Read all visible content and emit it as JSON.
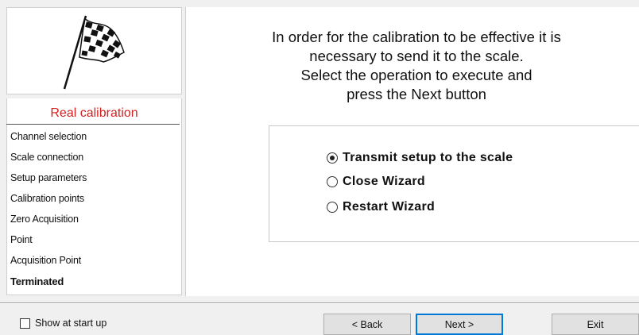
{
  "sidebar": {
    "title": "Real calibration",
    "steps": [
      "Channel selection",
      "Scale connection",
      "Setup parameters",
      "Calibration points",
      "Zero Acquisition",
      "Point",
      "Acquisition Point",
      "Terminated"
    ],
    "current_step": "Terminated",
    "title_color": "#d42020"
  },
  "main": {
    "instructions": [
      "In order for the calibration to be effective it is",
      "necessary to send it to the scale.",
      "Select the operation to execute and",
      "press the Next button"
    ],
    "options": [
      {
        "label": "Transmit setup to the scale",
        "selected": true
      },
      {
        "label": "Close Wizard",
        "selected": false
      },
      {
        "label": "Restart Wizard",
        "selected": false
      }
    ]
  },
  "footer": {
    "show_at_startup_label": "Show at start up",
    "show_at_startup_checked": false,
    "back_label": "< Back",
    "next_label": "Next >",
    "exit_label": "Exit"
  },
  "icons": {
    "flag": "checkered-flag-icon"
  }
}
